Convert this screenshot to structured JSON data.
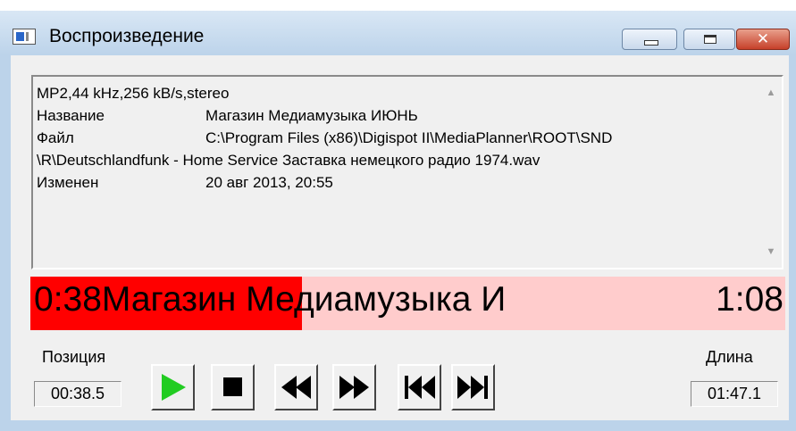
{
  "window": {
    "title": "Воспроизведение",
    "close_glyph": "✕"
  },
  "info": {
    "format": "MP2,44 kHz,256 kB/s,stereo",
    "title_label": "Название",
    "title_value": "Магазин Медиамузыка ИЮНЬ",
    "file_label": "Файл",
    "file_value": "C:\\Program Files (x86)\\Digispot II\\MediaPlanner\\ROOT\\SND",
    "file_cont": "\\R\\Deutschlandfunk - Home Service Заставка немецкого радио 1974.wav",
    "modified_label": "Изменен",
    "modified_value": "20 авг 2013, 20:55"
  },
  "progress": {
    "elapsed": "0:38",
    "track": "Магазин Медиамузыка И",
    "duration": "1:08",
    "fraction": 0.36,
    "fill_color": "#ff0000",
    "bg_color": "#ffcccc"
  },
  "position": {
    "label": "Позиция",
    "value": "00:38.5"
  },
  "length": {
    "label": "Длина",
    "value": "01:47.1"
  },
  "controls": {
    "play_icon": "play-icon",
    "stop_icon": "stop-icon",
    "rewind_icon": "rewind-icon",
    "forward_icon": "fast-forward-icon",
    "prev_icon": "skip-back-icon",
    "next_icon": "skip-forward-icon",
    "play_color": "#22cc22"
  }
}
